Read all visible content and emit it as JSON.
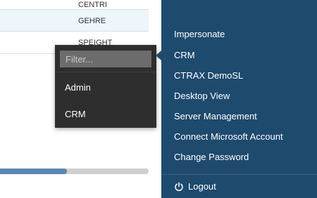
{
  "table": {
    "rows": [
      "CENTRI",
      "GEHRE",
      "SPEIGHT"
    ]
  },
  "progress": {
    "fraction": 0.46
  },
  "dropdown": {
    "filter_placeholder": "Filter...",
    "options": [
      "Admin",
      "CRM"
    ]
  },
  "menu": {
    "items": [
      "Impersonate",
      "CRM",
      "CTRAX DemoSL",
      "Desktop View",
      "Server Management",
      "Connect Microsoft Account",
      "Change Password"
    ],
    "logout_label": "Logout",
    "logout_icon": "power-icon"
  },
  "colors": {
    "panel": "#1e4a6e",
    "dropdown": "#2e2e2e",
    "progress_fill": "#5b86b4"
  }
}
